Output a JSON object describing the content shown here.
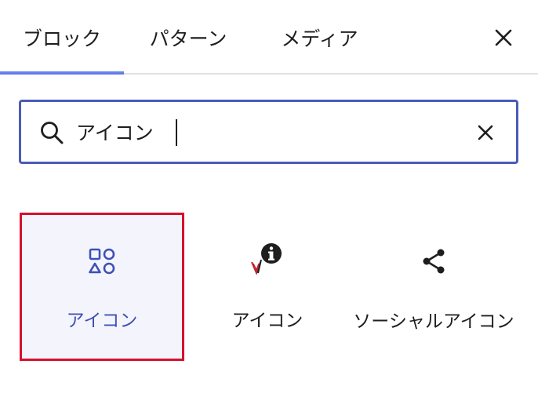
{
  "tabs": [
    {
      "label": "ブロック",
      "active": true
    },
    {
      "label": "パターン",
      "active": false
    },
    {
      "label": "メディア",
      "active": false
    }
  ],
  "close": {
    "icon": "close-icon"
  },
  "search": {
    "value": "アイコン",
    "icon": "search-icon",
    "clear_icon": "close-icon"
  },
  "results": [
    {
      "label": "アイコン",
      "icon": "shapes-icon",
      "selected": true
    },
    {
      "label": "アイコン",
      "icon": "info-plugin-icon",
      "selected": false
    },
    {
      "label": "ソーシャルアイコン",
      "icon": "share-icon",
      "selected": false
    }
  ],
  "colors": {
    "accent": "#3858e9",
    "selected_border": "#d6102c",
    "selected_bg": "#f4f5fc",
    "selected_text": "#3f51b5"
  }
}
